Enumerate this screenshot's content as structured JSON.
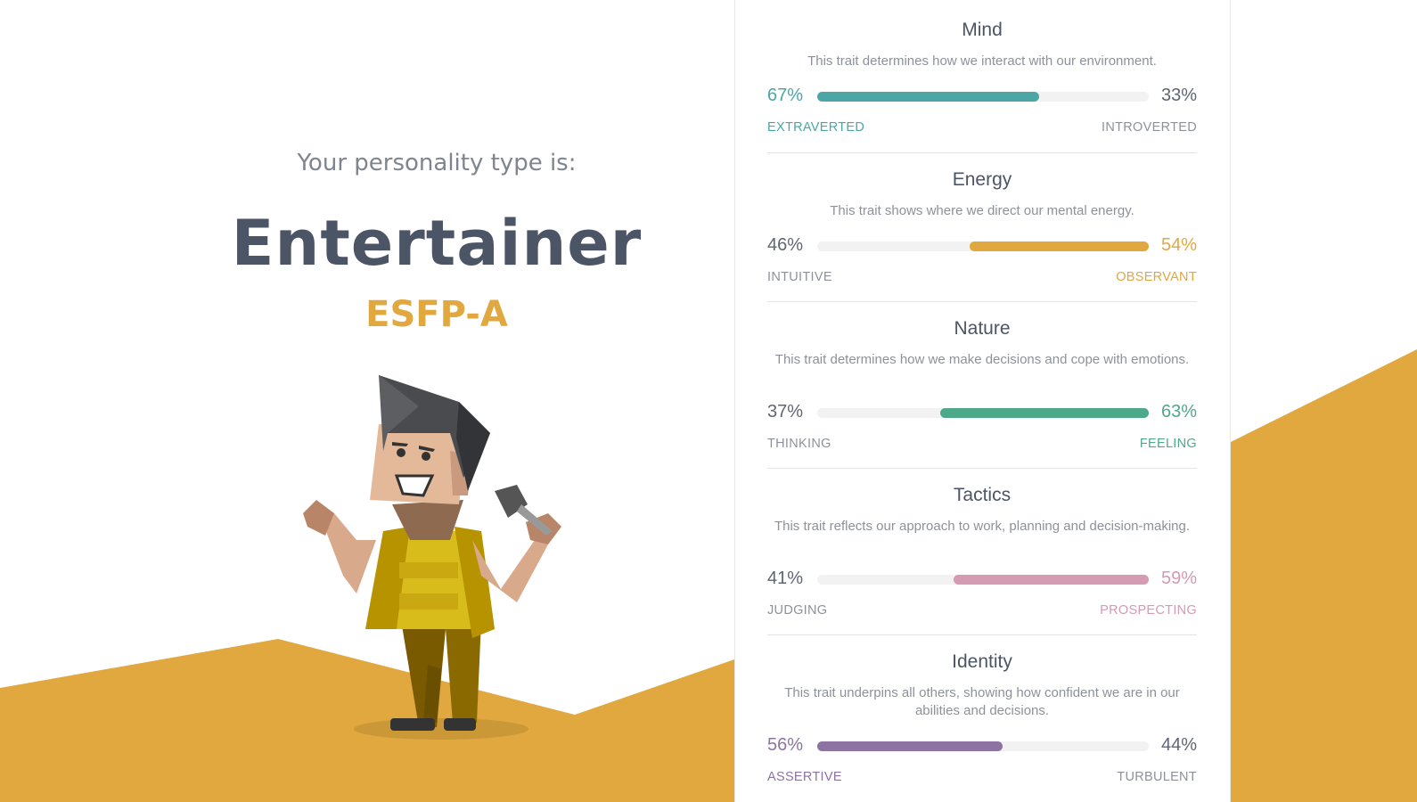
{
  "colors": {
    "accent": "#e0a83f",
    "title": "#4c5566",
    "mind": "#4ba6a5",
    "energy": "#e0a83f",
    "nature": "#4ea88a",
    "tactics": "#d49bb3",
    "identity": "#8d73a1"
  },
  "hero": {
    "intro": "Your personality type is:",
    "type_name": "Entertainer",
    "type_code": "ESFP-A"
  },
  "traits": [
    {
      "title": "Mind",
      "description": "This trait determines how we interact with our environment.",
      "left_percent": "67%",
      "right_percent": "33%",
      "left_label": "EXTRAVERTED",
      "right_label": "INTROVERTED",
      "dominant": "left",
      "value": 67,
      "color": "#4ba6a5"
    },
    {
      "title": "Energy",
      "description": "This trait shows where we direct our mental energy.",
      "left_percent": "46%",
      "right_percent": "54%",
      "left_label": "INTUITIVE",
      "right_label": "OBSERVANT",
      "dominant": "right",
      "value": 54,
      "color": "#e0a83f"
    },
    {
      "title": "Nature",
      "description": "This trait determines how we make decisions and cope with emotions.",
      "left_percent": "37%",
      "right_percent": "63%",
      "left_label": "THINKING",
      "right_label": "FEELING",
      "dominant": "right",
      "value": 63,
      "color": "#4ea88a"
    },
    {
      "title": "Tactics",
      "description": "This trait reflects our approach to work, planning and decision-making.",
      "left_percent": "41%",
      "right_percent": "59%",
      "left_label": "JUDGING",
      "right_label": "PROSPECTING",
      "dominant": "right",
      "value": 59,
      "color": "#d49bb3"
    },
    {
      "title": "Identity",
      "description": "This trait underpins all others, showing how confident we are in our abilities and decisions.",
      "left_percent": "56%",
      "right_percent": "44%",
      "left_label": "ASSERTIVE",
      "right_label": "TURBULENT",
      "dominant": "left",
      "value": 56,
      "color": "#8d73a1"
    }
  ]
}
